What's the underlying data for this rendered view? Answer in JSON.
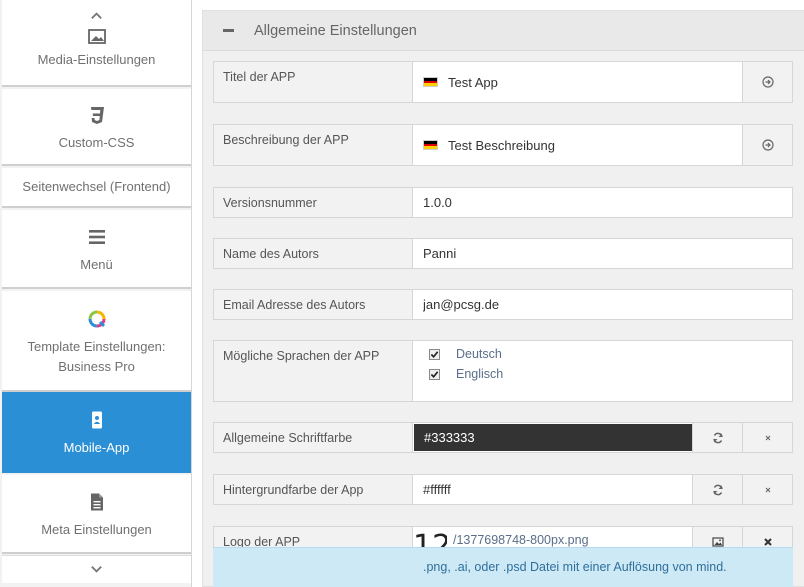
{
  "sidebar": {
    "items": [
      {
        "label": "Media-Einstellungen",
        "icon": "image-icon"
      },
      {
        "label": "Custom-CSS",
        "icon": "css3-icon"
      },
      {
        "label": "Seitenwechsel (Frontend)",
        "icon": ""
      },
      {
        "label": "Menü",
        "icon": "menu-icon"
      },
      {
        "label": "Template Einstellungen: Business Pro",
        "icon": "quiqqer-logo-icon"
      },
      {
        "label": "Mobile-App",
        "icon": "mobile-icon",
        "active": true
      },
      {
        "label": "Meta Einstellungen",
        "icon": "file-text-icon"
      }
    ]
  },
  "section": {
    "title": "Allgemeine Einstellungen"
  },
  "fields": {
    "app_title": {
      "label": "Titel der APP",
      "value": "Test App"
    },
    "app_description": {
      "label": "Beschreibung der APP",
      "value": "Test Beschreibung"
    },
    "version": {
      "label": "Versionsnummer",
      "value": "1.0.0"
    },
    "author_name": {
      "label": "Name des Autors",
      "value": "Panni"
    },
    "author_email": {
      "label": "Email Adresse des Autors",
      "value": "jan@pcsg.de"
    },
    "languages": {
      "label": "Mögliche Sprachen der APP",
      "options": [
        {
          "label": "Deutsch",
          "checked": true
        },
        {
          "label": "Englisch",
          "checked": true
        }
      ]
    },
    "font_color": {
      "label": "Allgemeine Schriftfarbe",
      "value": "#333333"
    },
    "background_color": {
      "label": "Hintergrundfarbe der App",
      "value": "#ffffff"
    },
    "logo": {
      "label": "Logo der APP",
      "value": "/1377698748-800px.png",
      "thumb_text": "12"
    }
  },
  "info": {
    "text": ".png, .ai, oder .psd Datei mit einer Auflösung von mind."
  },
  "colors": {
    "accent": "#2b8fd6",
    "flag_de": [
      "#000000",
      "#dd0000",
      "#ffce00"
    ]
  }
}
